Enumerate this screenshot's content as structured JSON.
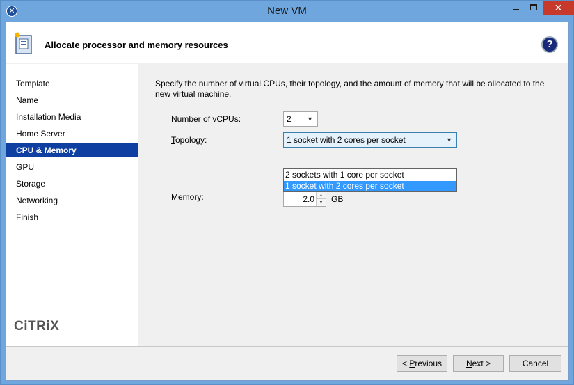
{
  "window": {
    "title": "New VM",
    "close_glyph": "✕"
  },
  "header": {
    "title": "Allocate processor and memory resources",
    "help_glyph": "?"
  },
  "sidebar": {
    "items": [
      {
        "label": "Template"
      },
      {
        "label": "Name"
      },
      {
        "label": "Installation Media"
      },
      {
        "label": "Home Server"
      },
      {
        "label": "CPU & Memory",
        "selected": true
      },
      {
        "label": "GPU"
      },
      {
        "label": "Storage"
      },
      {
        "label": "Networking"
      },
      {
        "label": "Finish"
      }
    ],
    "logo_text": "CiTRiX"
  },
  "content": {
    "intro": "Specify the number of virtual CPUs, their topology, and the amount of memory that will be allocated to the new virtual machine.",
    "vcpus": {
      "label_pre": "Number of v",
      "label_mnemonic": "C",
      "label_post": "PUs:",
      "value": "2"
    },
    "topology": {
      "label_mnemonic": "T",
      "label_post": "opology:",
      "value": "1 socket with 2 cores per socket",
      "options": [
        "2 sockets with 1 core per socket",
        "1 socket with 2 cores per socket"
      ],
      "highlighted_index": 1
    },
    "memory": {
      "label_mnemonic": "M",
      "label_post": "emory:",
      "value": "2.0",
      "unit": "GB"
    }
  },
  "buttons": {
    "previous": {
      "pre": "< ",
      "mnemonic": "P",
      "post": "revious"
    },
    "next": {
      "pre": "",
      "mnemonic": "N",
      "post": "ext >"
    },
    "cancel": {
      "label": "Cancel"
    }
  },
  "colors": {
    "titlebar": "#6fa6dd",
    "selected_nav": "#0f3fa0",
    "dropdown_highlight": "#3399ff",
    "close_button": "#c7392b"
  },
  "icons": {
    "app": "xen-app-icon",
    "header": "vm-wizard-icon",
    "help": "help-icon"
  }
}
